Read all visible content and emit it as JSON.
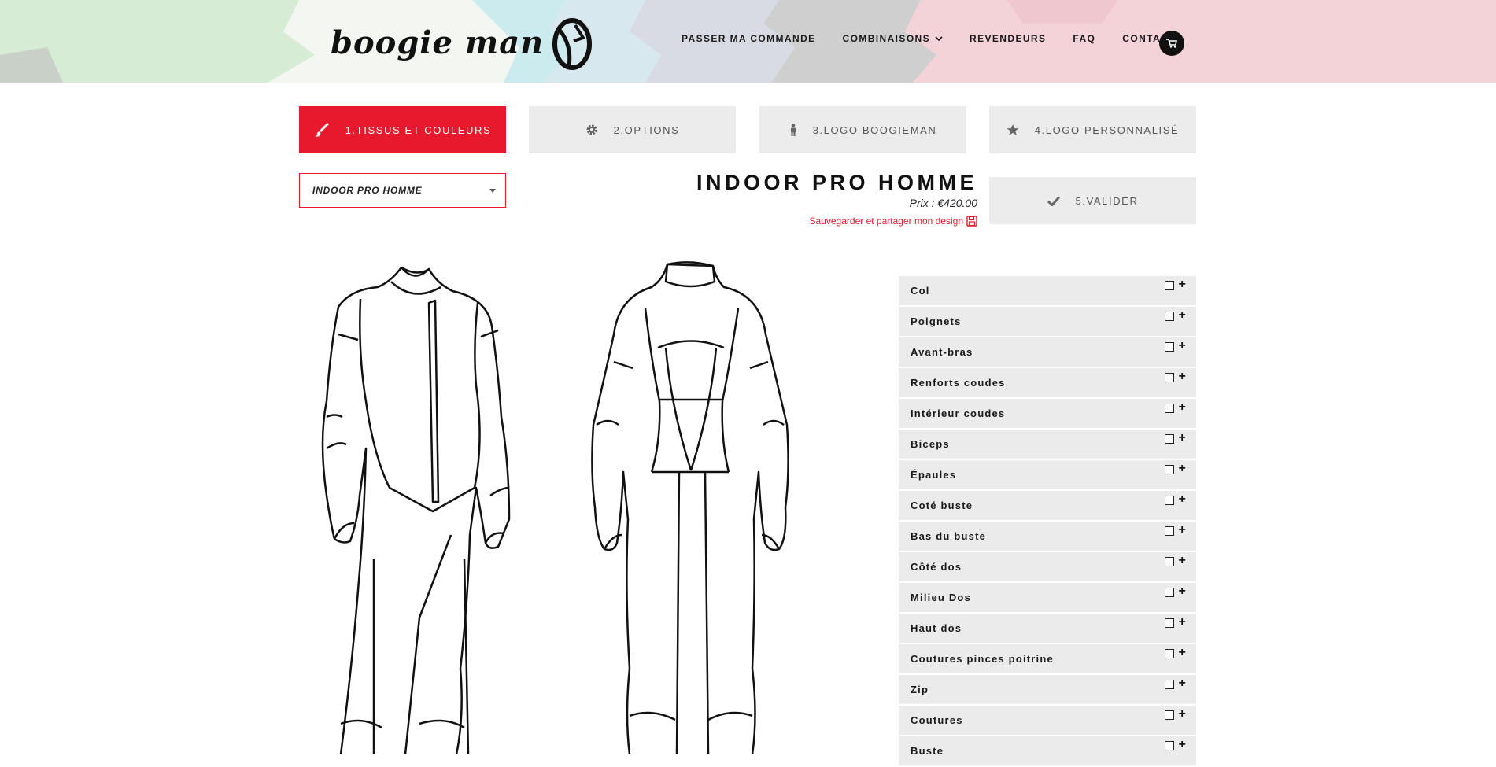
{
  "brand": {
    "name": "boogie man"
  },
  "nav": {
    "items": [
      {
        "label": "PASSER MA COMMANDE"
      },
      {
        "label": "COMBINAISONS"
      },
      {
        "label": "REVENDEURS"
      },
      {
        "label": "FAQ"
      },
      {
        "label": "CONTACT"
      }
    ],
    "cart_icon": "cart-icon"
  },
  "steps": [
    {
      "label": "1.TISSUS ET COULEURS",
      "icon": "brush-icon",
      "active": true
    },
    {
      "label": "2.OPTIONS",
      "icon": "gear-icon",
      "active": false
    },
    {
      "label": "3.LOGO BOOGIEMAN",
      "icon": "person-icon",
      "active": false
    },
    {
      "label": "4.LOGO PERSONNALISÉ",
      "icon": "star-icon",
      "active": false
    },
    {
      "label": "5.VALIDER",
      "icon": "check-icon",
      "active": false
    }
  ],
  "model_select": {
    "value": "INDOOR PRO HOMME"
  },
  "product": {
    "title": "INDOOR PRO HOMME",
    "price": "Prix : €420.00",
    "save_label": "Sauvegarder et partager mon design"
  },
  "parts": [
    "Col",
    "Poignets",
    "Avant-bras",
    "Renforts coudes",
    "Intérieur coudes",
    "Biceps",
    "Épaules",
    "Coté buste",
    "Bas du buste",
    "Côté dos",
    "Milieu Dos",
    "Haut dos",
    "Coutures pinces poitrine",
    "Zip",
    "Coutures",
    "Buste"
  ],
  "colors": {
    "accent": "#e8192c",
    "panel": "#ebebeb"
  }
}
